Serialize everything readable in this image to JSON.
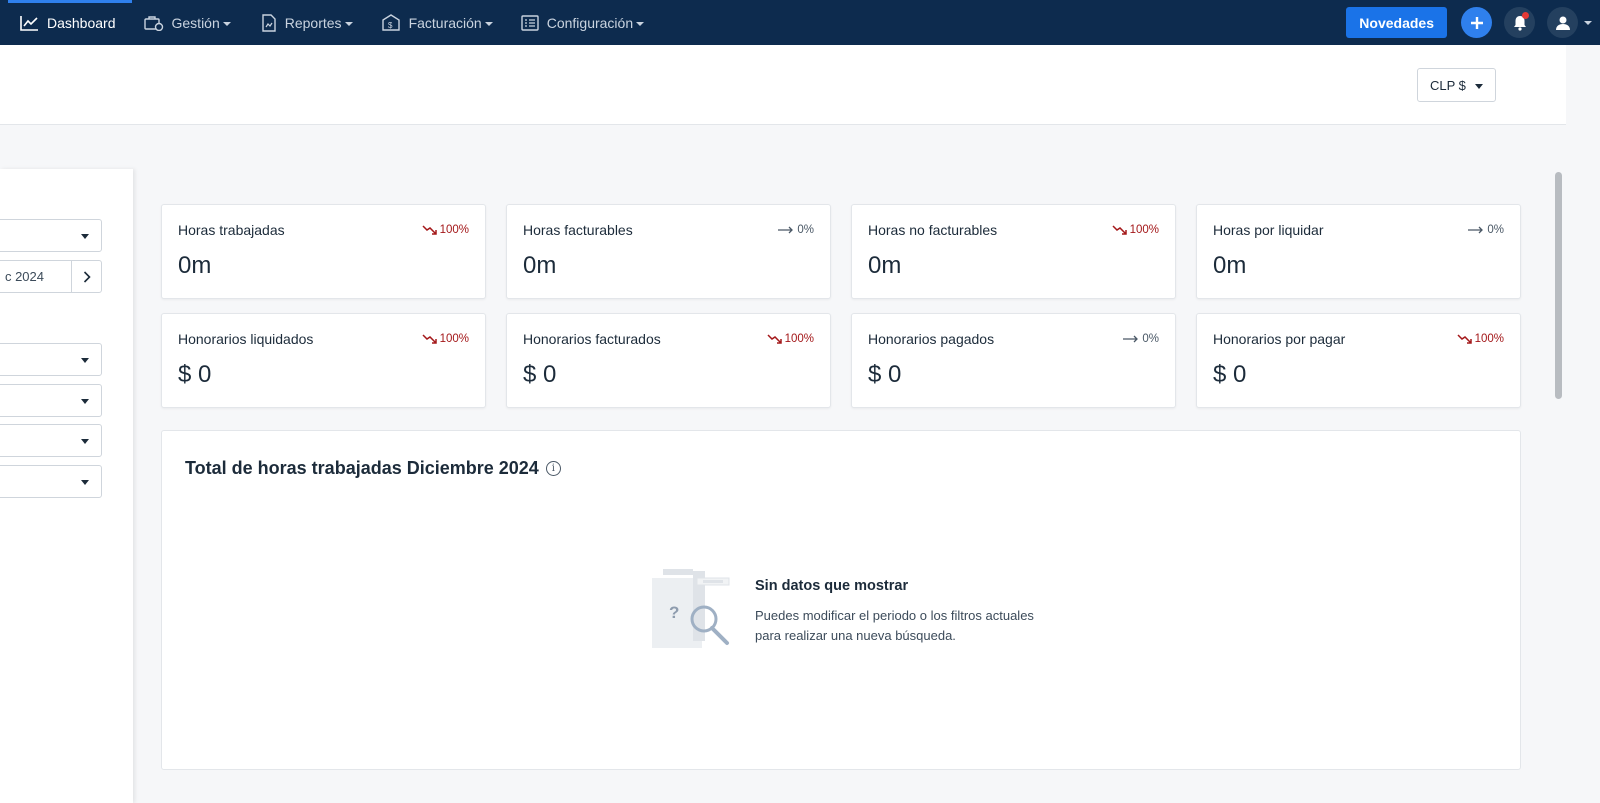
{
  "nav": {
    "items": [
      {
        "label": "Dashboard",
        "icon": "chart-line-icon",
        "active": true
      },
      {
        "label": "Gestión",
        "icon": "briefcase-icon"
      },
      {
        "label": "Reportes",
        "icon": "report-icon"
      },
      {
        "label": "Facturación",
        "icon": "invoice-icon"
      },
      {
        "label": "Configuración",
        "icon": "list-icon"
      }
    ],
    "novedades_label": "Novedades"
  },
  "header": {
    "currency": "CLP $"
  },
  "filters": {
    "date_text": "c 2024"
  },
  "kpis": [
    {
      "label": "Horas trabajadas",
      "value": "0m",
      "trend": "100%",
      "direction": "down"
    },
    {
      "label": "Horas facturables",
      "value": "0m",
      "trend": "0%",
      "direction": "flat"
    },
    {
      "label": "Horas no facturables",
      "value": "0m",
      "trend": "100%",
      "direction": "down"
    },
    {
      "label": "Horas por liquidar",
      "value": "0m",
      "trend": "0%",
      "direction": "flat"
    },
    {
      "label": "Honorarios liquidados",
      "value": "$ 0",
      "trend": "100%",
      "direction": "down"
    },
    {
      "label": "Honorarios facturados",
      "value": "$ 0",
      "trend": "100%",
      "direction": "down"
    },
    {
      "label": "Honorarios pagados",
      "value": "$ 0",
      "trend": "0%",
      "direction": "flat"
    },
    {
      "label": "Honorarios por pagar",
      "value": "$ 0",
      "trend": "100%",
      "direction": "down"
    }
  ],
  "chart": {
    "title": "Total de horas trabajadas Diciembre 2024",
    "empty_title": "Sin datos que mostrar",
    "empty_text": "Puedes modificar el periodo o los filtros actuales para realizar una nueva búsqueda."
  },
  "colors": {
    "nav_bg": "#0d2b4e",
    "primary": "#1a73e8",
    "trend_down": "#a4181a"
  }
}
